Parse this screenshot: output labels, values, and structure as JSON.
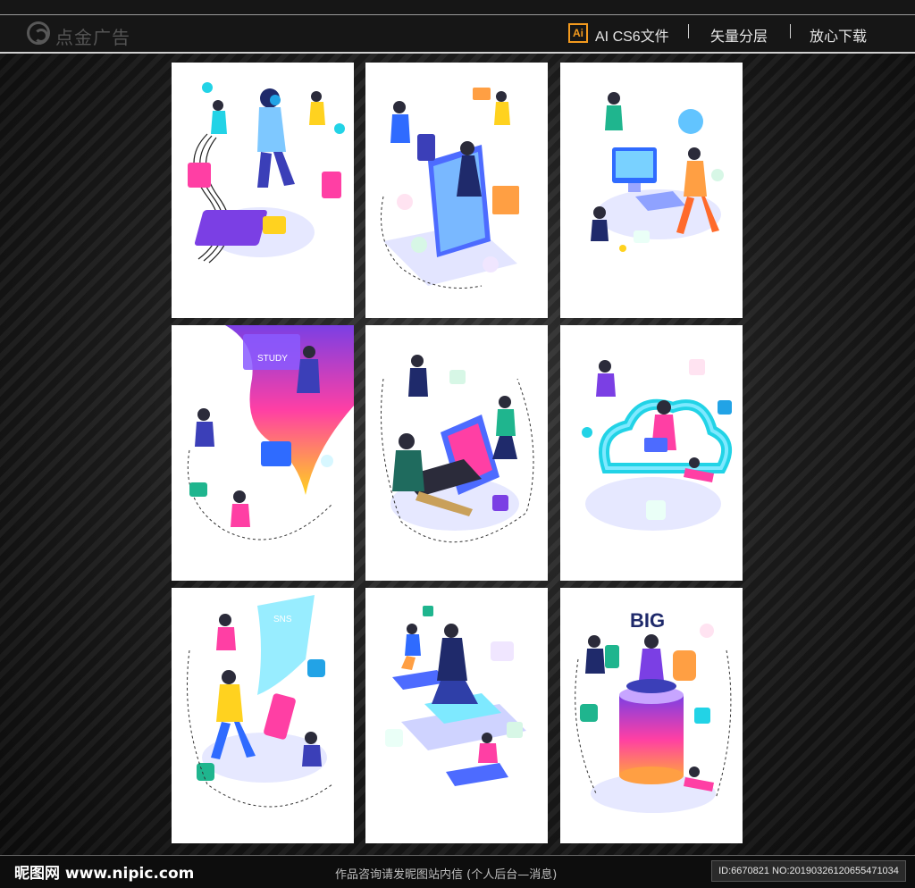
{
  "header": {
    "logo_text": "点金广告",
    "file_badge": "Ai",
    "file_type": "AI CS6文件",
    "layered": "矢量分层",
    "download": "放心下载"
  },
  "gallery": {
    "cards": [
      {
        "id": "music"
      },
      {
        "id": "shopping"
      },
      {
        "id": "media"
      },
      {
        "id": "study",
        "label": "STUDY"
      },
      {
        "id": "coding"
      },
      {
        "id": "cloud"
      },
      {
        "id": "sns",
        "label": "SNS"
      },
      {
        "id": "mobile"
      },
      {
        "id": "bigdata",
        "label": "BIG"
      }
    ]
  },
  "footer": {
    "site": "昵图网 www.nipic.com",
    "notice": "作品咨询请发昵图站内信 (个人后台—消息)",
    "image_id": "ID:6670821 NO:20190326120655471034"
  },
  "colors": {
    "accent_orange": "#f39a1e",
    "purple": "#7b3fe4",
    "pink": "#ff3fa4",
    "cyan": "#22d3e6",
    "navy": "#1f2a6b",
    "yellow": "#ffd21f"
  }
}
